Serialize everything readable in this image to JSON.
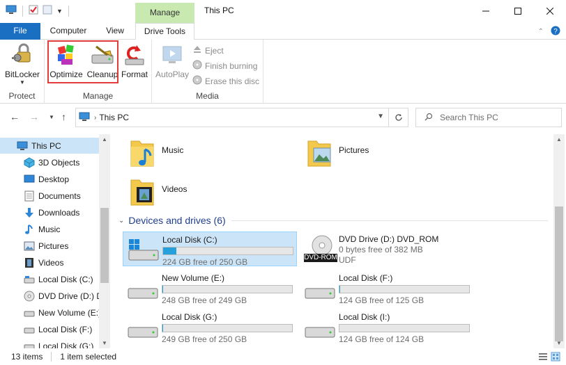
{
  "window": {
    "title": "This PC",
    "context_tab": "Manage"
  },
  "tabs": {
    "file": "File",
    "computer": "Computer",
    "view": "View",
    "drive_tools": "Drive Tools"
  },
  "ribbon": {
    "protect": {
      "label": "Protect",
      "bitlocker": "BitLocker"
    },
    "manage": {
      "label": "Manage",
      "optimize": "Optimize",
      "cleanup": "Cleanup",
      "format": "Format"
    },
    "media": {
      "label": "Media",
      "autoplay": "AutoPlay",
      "eject": "Eject",
      "finish_burning": "Finish burning",
      "erase_disc": "Erase this disc"
    }
  },
  "address": {
    "crumb": "This PC"
  },
  "search": {
    "placeholder": "Search This PC"
  },
  "nav": {
    "items": [
      {
        "label": "This PC",
        "icon": "pc-icon"
      },
      {
        "label": "3D Objects",
        "icon": "3d-objects-icon"
      },
      {
        "label": "Desktop",
        "icon": "desktop-icon"
      },
      {
        "label": "Documents",
        "icon": "documents-icon"
      },
      {
        "label": "Downloads",
        "icon": "downloads-icon"
      },
      {
        "label": "Music",
        "icon": "music-icon"
      },
      {
        "label": "Pictures",
        "icon": "pictures-icon"
      },
      {
        "label": "Videos",
        "icon": "videos-icon"
      },
      {
        "label": "Local Disk (C:)",
        "icon": "drive-icon"
      },
      {
        "label": "DVD Drive (D:) D",
        "icon": "dvd-icon"
      },
      {
        "label": "New Volume (E:)",
        "icon": "drive-icon"
      },
      {
        "label": "Local Disk (F:)",
        "icon": "drive-icon"
      },
      {
        "label": "Local Disk (G:)",
        "icon": "drive-icon"
      }
    ]
  },
  "folders": {
    "music": "Music",
    "pictures": "Pictures",
    "videos": "Videos"
  },
  "devices": {
    "heading": "Devices and drives (6)",
    "dvd_badge": "DVD-ROM",
    "drives": [
      {
        "name": "Local Disk (C:)",
        "free": "224 GB free of 250 GB",
        "used_fraction": 0.104
      },
      {
        "name": "DVD Drive (D:) DVD_ROM",
        "free": "0 bytes free of 382 MB",
        "fs": "UDF"
      },
      {
        "name": "New Volume (E:)",
        "free": "248 GB free of 249 GB",
        "used_fraction": 0.004
      },
      {
        "name": "Local Disk (F:)",
        "free": "124 GB free of 125 GB",
        "used_fraction": 0.008
      },
      {
        "name": "Local Disk (G:)",
        "free": "249 GB free of 250 GB",
        "used_fraction": 0.004
      },
      {
        "name": "Local Disk (I:)",
        "free": "124 GB free of 124 GB",
        "used_fraction": 0.0
      }
    ]
  },
  "status": {
    "items": "13 items",
    "selected": "1 item selected"
  },
  "colors": {
    "accent": "#1a6fc2",
    "context_tab": "#c8eab0",
    "selection": "#cce4f7",
    "usage_bar": "#26a0da",
    "highlight_box": "#e23b3b"
  }
}
